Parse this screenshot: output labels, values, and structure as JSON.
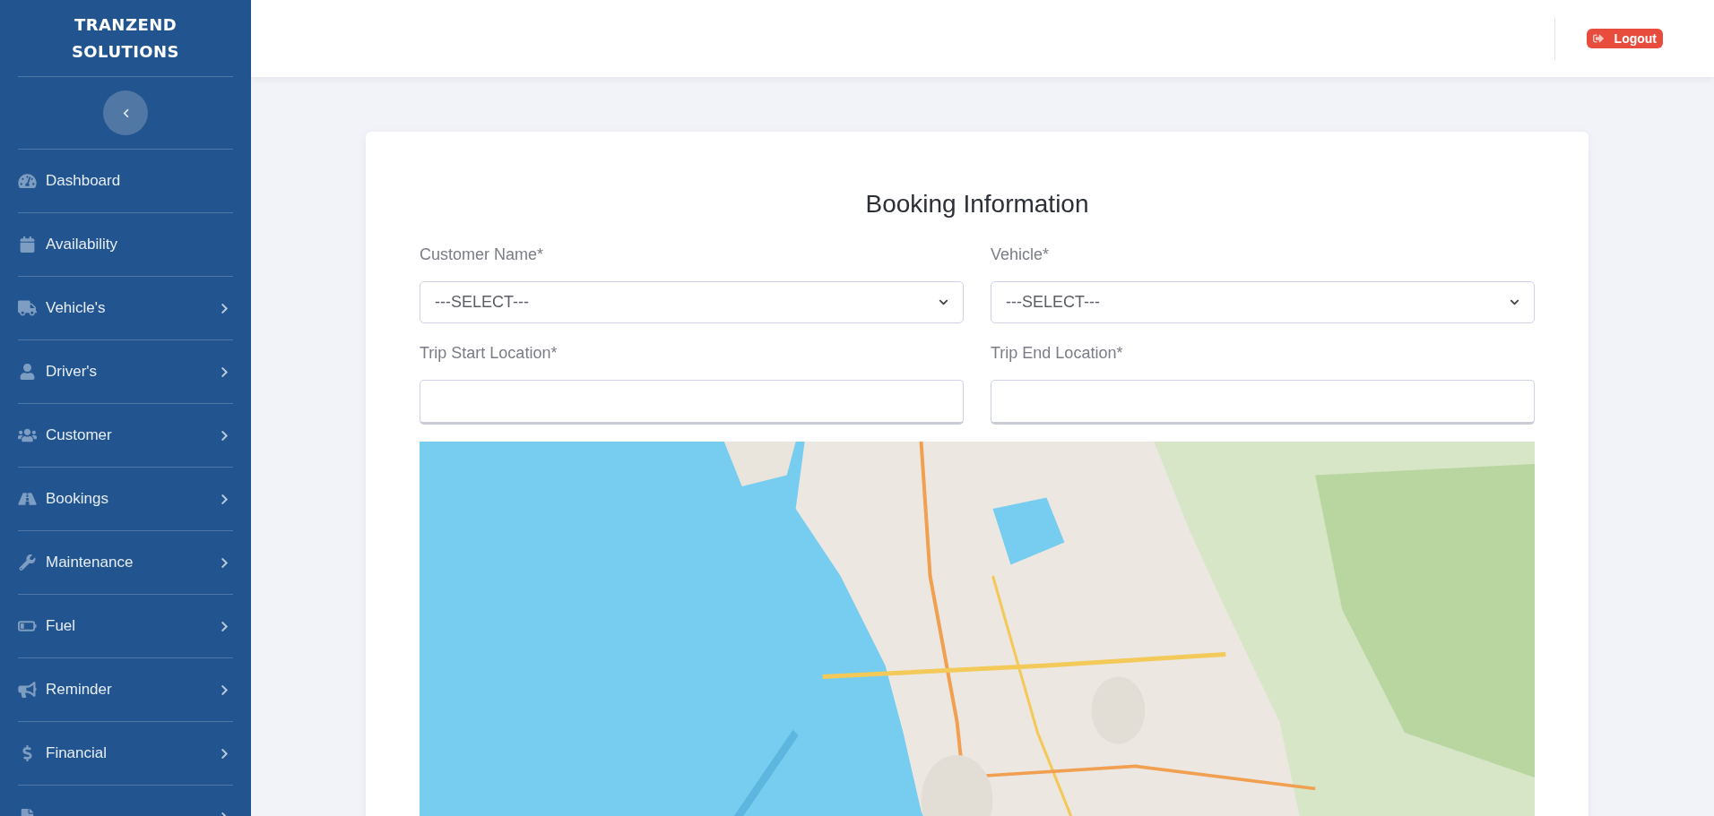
{
  "brand": {
    "line_1": "TRANZEND",
    "line_2": "SOLUTIONS"
  },
  "sidebar": {
    "items": [
      {
        "label": "Dashboard",
        "has_submenu": false
      },
      {
        "label": "Availability",
        "has_submenu": false
      },
      {
        "label": "Vehicle's",
        "has_submenu": true
      },
      {
        "label": "Driver's",
        "has_submenu": true
      },
      {
        "label": "Customer",
        "has_submenu": true
      },
      {
        "label": "Bookings",
        "has_submenu": true
      },
      {
        "label": "Maintenance",
        "has_submenu": true
      },
      {
        "label": "Fuel",
        "has_submenu": true
      },
      {
        "label": "Reminder",
        "has_submenu": true
      },
      {
        "label": "Financial",
        "has_submenu": true
      },
      {
        "has_submenu": true
      }
    ]
  },
  "header": {
    "logout": "Logout"
  },
  "form": {
    "title": "Booking Information",
    "fields": [
      {
        "kind": "select",
        "label": "Customer Name*",
        "value": "---SELECT---"
      },
      {
        "kind": "select",
        "label": "Vehicle*",
        "value": "---SELECT---"
      },
      {
        "kind": "text",
        "label": "Trip Start Location*"
      },
      {
        "kind": "text",
        "label": "Trip End Location*"
      }
    ]
  }
}
